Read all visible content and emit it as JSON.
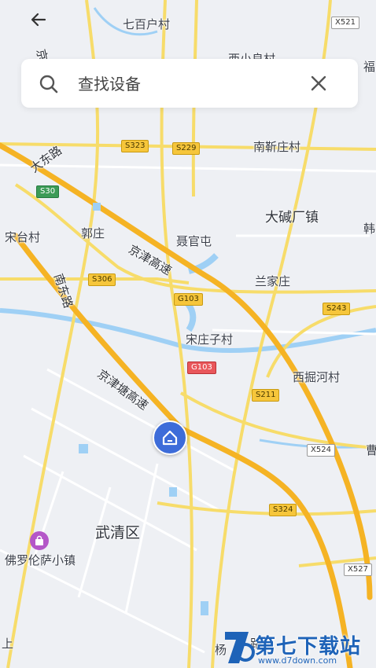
{
  "search": {
    "placeholder": "查找设备",
    "value": ""
  },
  "map": {
    "place_labels": {
      "qibaihucun": "七百户村",
      "xixiaobaocun": "西小良村",
      "nanjinzhuangcun": "南靳庄村",
      "dajianchangzhen": "大碱厂镇",
      "songtaicun": "宋台村",
      "guozhuang": "郭庄",
      "nieguantun": "聂官屯",
      "lanjiazhuang": "兰家庄",
      "songzhuangzicun": "宋庄子村",
      "xijuehecun": "西掘河村",
      "wuqingqu": "武清区",
      "fuluolunsa": "佛罗伦萨小镇",
      "fu": "福",
      "han": "韩",
      "cao": "曹",
      "shang": "上",
      "yang": "杨"
    },
    "road_labels": {
      "jing_top": "京津",
      "dadonglu": "大东路",
      "jingjin_gaosu": "京津高速",
      "nandonglu": "南东路",
      "jingjintang_gaosu": "京津塘高速",
      "lu_bottom": "路"
    },
    "shields": {
      "x521": "X521",
      "s323": "S323",
      "s229": "S229",
      "s30": "S30",
      "s306": "S306",
      "g103_a": "G103",
      "g103_b": "G103",
      "s243": "S243",
      "s211": "S211",
      "x524": "X524",
      "s324": "S324",
      "x527": "X527"
    },
    "colors": {
      "expressway": "#f5b324",
      "highway": "#f7dc6a",
      "river": "#9fd0f5",
      "background": "#eef0f4",
      "marker": "#3d6cd9"
    }
  },
  "watermark": {
    "text": "第七下载站",
    "url": "www.d7down.com"
  }
}
